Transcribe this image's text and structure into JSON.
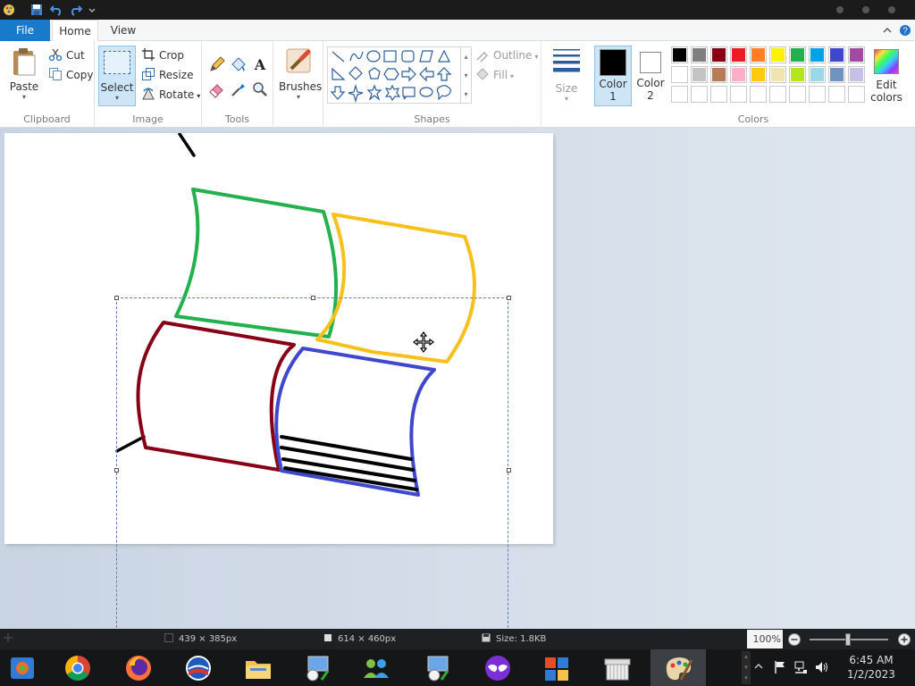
{
  "ribbon": {
    "tabs": {
      "file": "File",
      "home": "Home",
      "view": "View"
    },
    "clipboard": {
      "paste": "Paste",
      "cut": "Cut",
      "copy": "Copy",
      "label": "Clipboard"
    },
    "image": {
      "select": "Select",
      "crop": "Crop",
      "resize": "Resize",
      "rotate": "Rotate",
      "label": "Image"
    },
    "tools": {
      "label": "Tools"
    },
    "brushes": {
      "label": "Brushes"
    },
    "shapes": {
      "outline": "Outline",
      "fill": "Fill",
      "label": "Shapes"
    },
    "size": {
      "label": "Size"
    },
    "colors": {
      "color1": "Color\n1",
      "color2": "Color\n2",
      "edit": "Edit\ncolors",
      "label": "Colors",
      "color1_value": "#000000",
      "color2_value": "#ffffff",
      "palette_row1": [
        "#000000",
        "#7f7f7f",
        "#880015",
        "#ed1c24",
        "#ff7f27",
        "#fff200",
        "#22b14c",
        "#00a2e8",
        "#3f48cc",
        "#a349a4"
      ],
      "palette_row2": [
        "#ffffff",
        "#c3c3c3",
        "#b97a57",
        "#ffaec9",
        "#ffc90e",
        "#efe4b0",
        "#b5e61d",
        "#99d9ea",
        "#7092be",
        "#c8bfe7"
      ],
      "palette_row3": [
        "#ffffff",
        "#ffffff",
        "#ffffff",
        "#ffffff",
        "#ffffff",
        "#ffffff",
        "#ffffff",
        "#ffffff",
        "#ffffff",
        "#ffffff"
      ]
    }
  },
  "statusbar": {
    "selection_size": "439 × 385px",
    "canvas_size": "614 × 460px",
    "file_size": "Size: 1.8KB",
    "zoom": "100%"
  },
  "taskbar": {
    "apps": [
      "photo-viewer",
      "chrome",
      "firefox",
      "obama-logo-app",
      "file-explorer",
      "network-app",
      "people-app",
      "network-app-2",
      "mask-app",
      "office-app",
      "archive-app",
      "paint-app"
    ],
    "time": "6:45 AM",
    "date": "1/2/2023"
  },
  "icons": {
    "move_cursor": "move-cursor-icon"
  }
}
